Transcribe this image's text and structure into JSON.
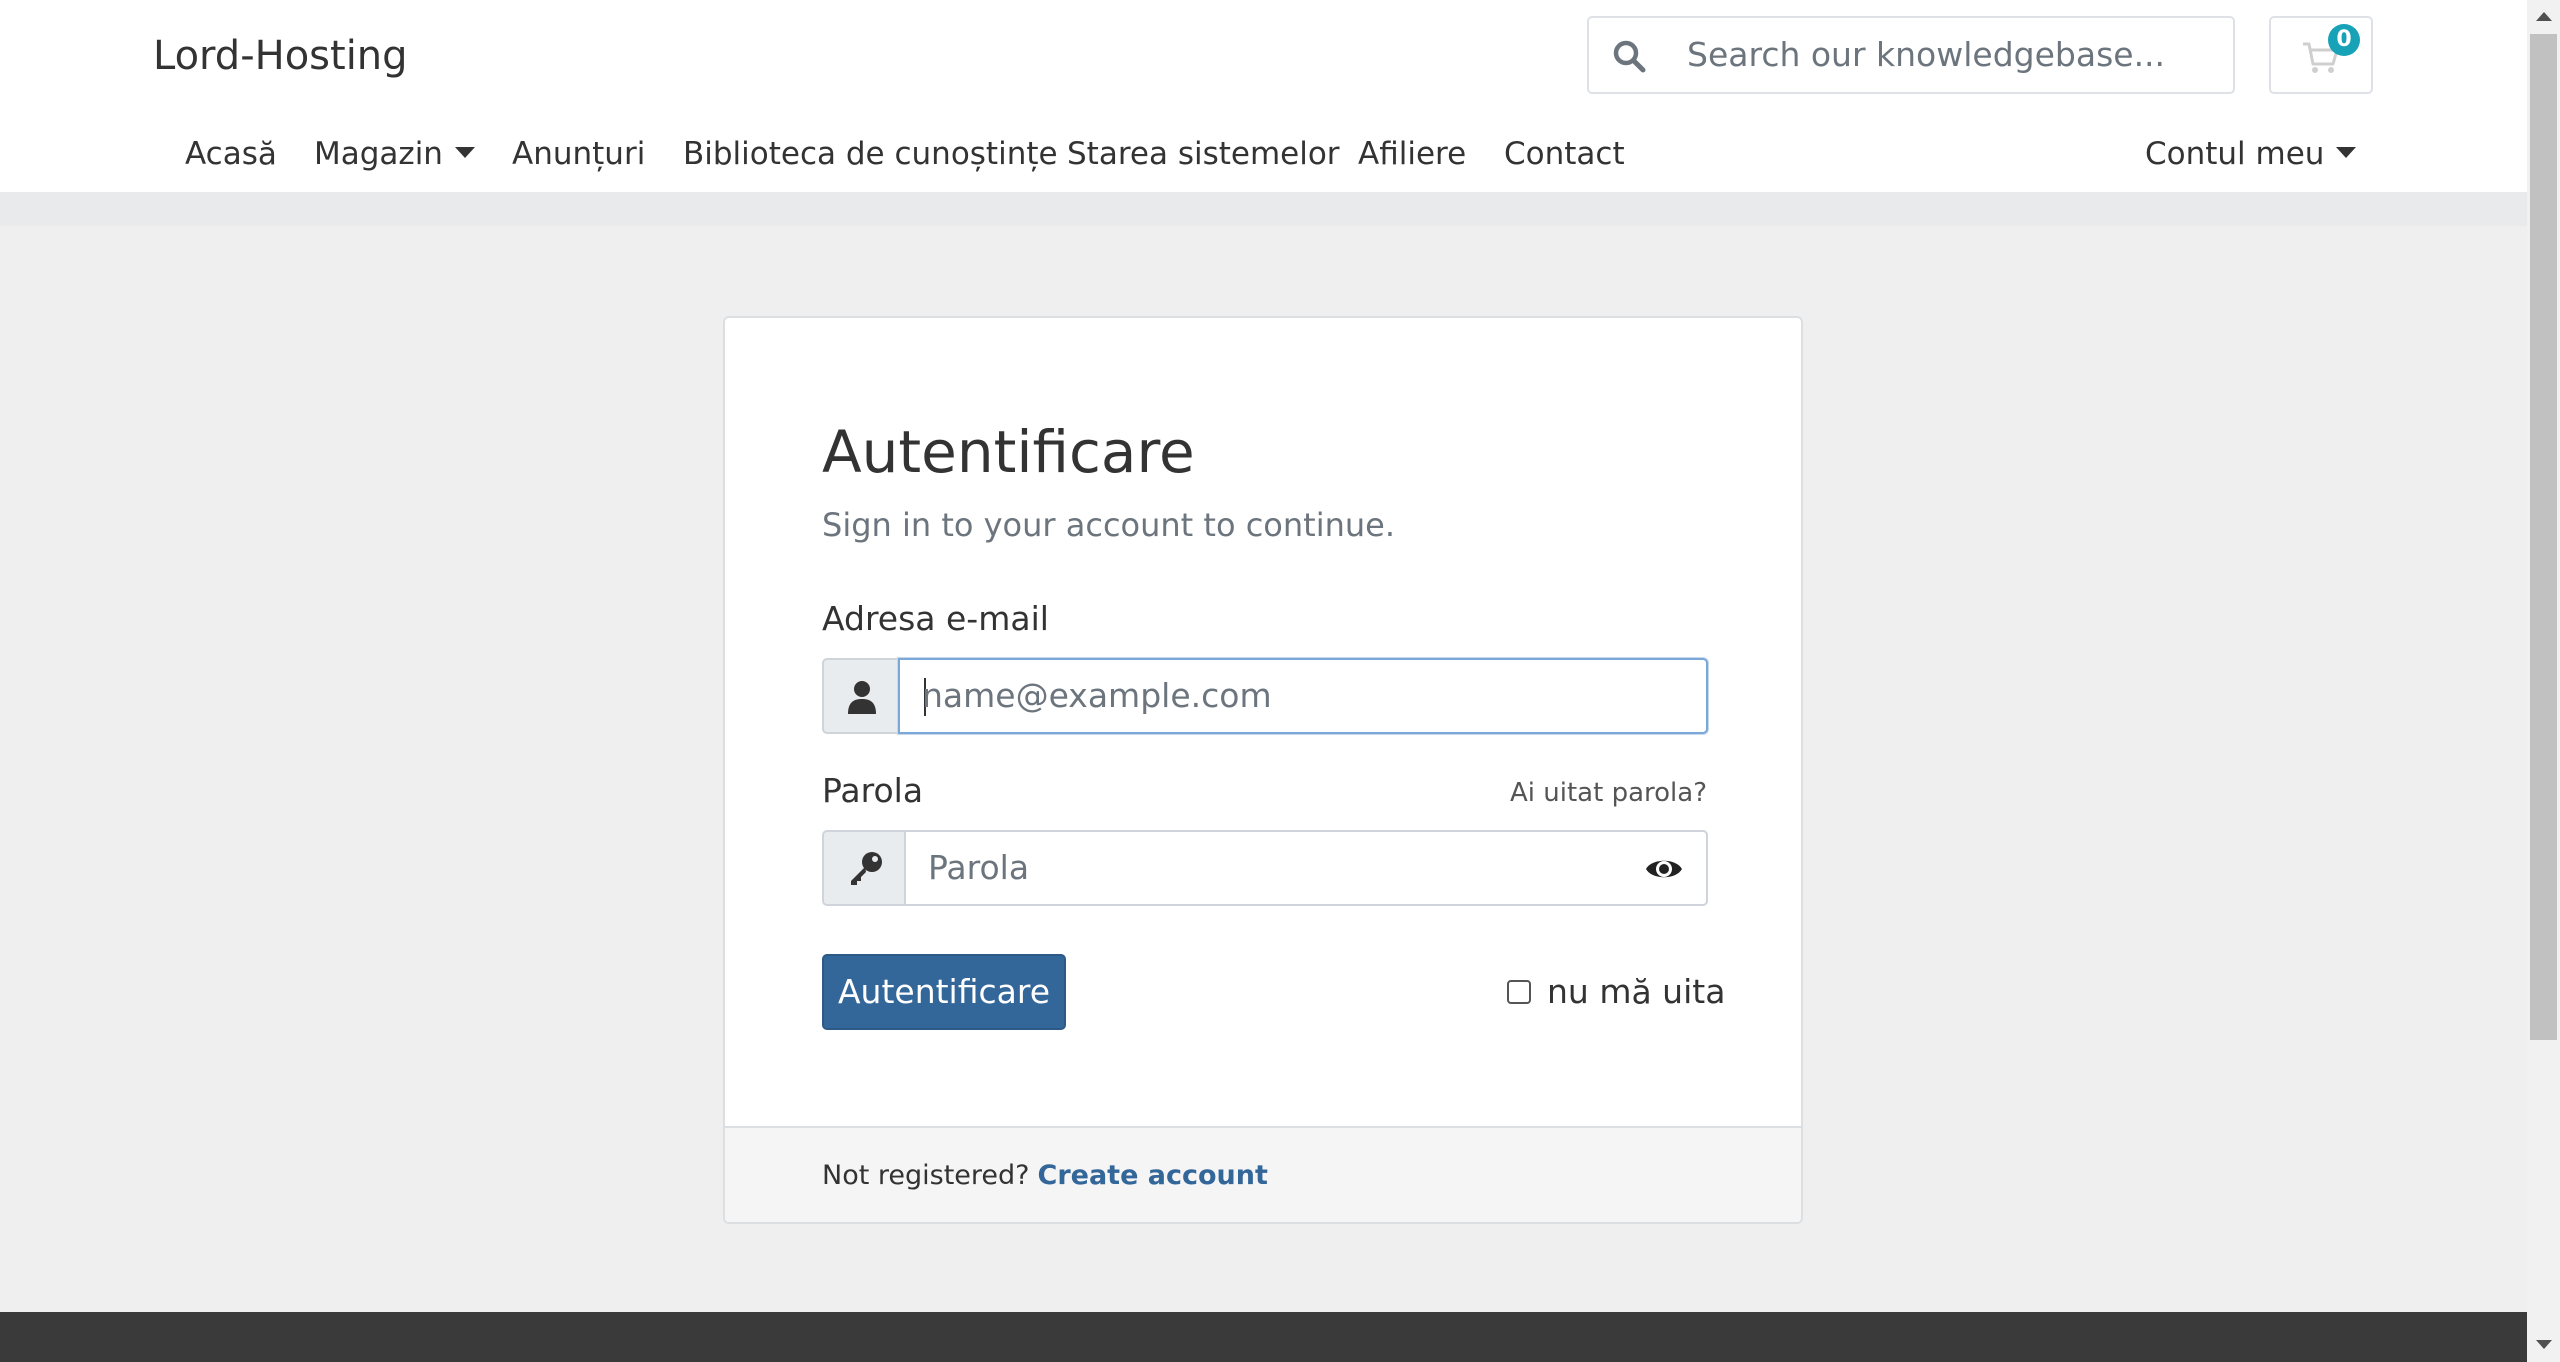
{
  "header": {
    "brand": "Lord-Hosting",
    "search_placeholder": "Search our knowledgebase...",
    "cart_count": "0"
  },
  "nav": {
    "home": "Acasă",
    "store": "Magazin",
    "announcements": "Anunțuri",
    "knowledgebase": "Biblioteca de cunoștințe",
    "status": "Starea sistemelor",
    "affiliates": "Afiliere",
    "contact": "Contact",
    "account": "Contul meu"
  },
  "login": {
    "title": "Autentificare",
    "subtitle": "Sign in to your account to continue.",
    "email_label": "Adresa e-mail",
    "email_placeholder": "name@example.com",
    "password_label": "Parola",
    "forgot_link": "Ai uitat parola?",
    "password_placeholder": "Parola",
    "submit_label": "Autentificare",
    "remember_label": "nu mă uita",
    "footer_text": "Not registered?",
    "create_account": "Create account"
  },
  "colors": {
    "primary": "#336699",
    "badge": "#17a2b8",
    "footer": "#3a3a3a"
  }
}
